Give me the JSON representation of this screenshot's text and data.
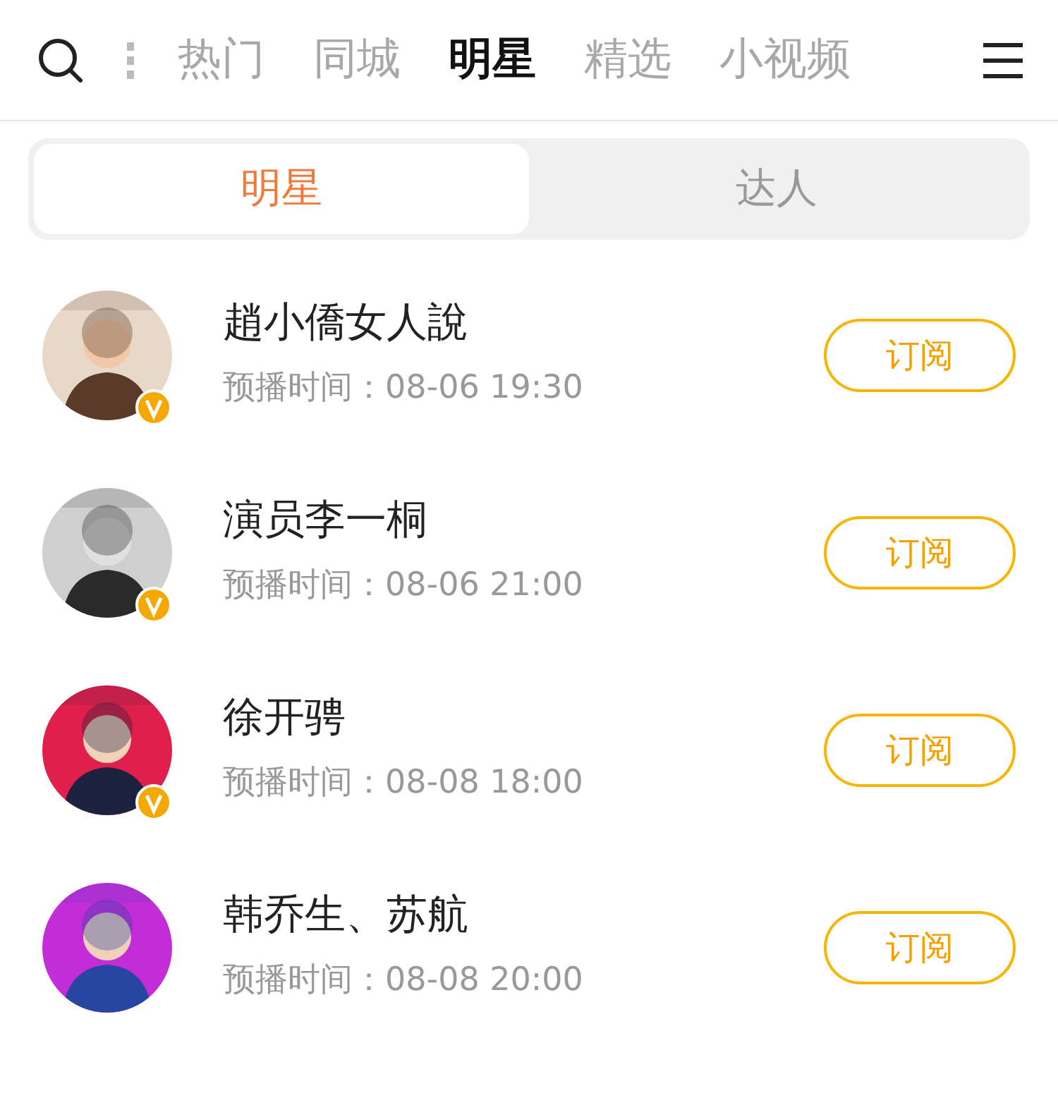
{
  "top_tabs": [
    {
      "label": "热门",
      "selected": false
    },
    {
      "label": "同城",
      "selected": false
    },
    {
      "label": "明星",
      "selected": true
    },
    {
      "label": "精选",
      "selected": false
    },
    {
      "label": "小视频",
      "selected": false
    }
  ],
  "segments": [
    {
      "label": "明星",
      "selected": true
    },
    {
      "label": "达人",
      "selected": false
    }
  ],
  "streams": [
    {
      "name": "趙小僑女人說",
      "time_label": "预播时间：",
      "time": "08-06 19:30",
      "verified": true,
      "button": "订阅"
    },
    {
      "name": "演员李一桐",
      "time_label": "预播时间：",
      "time": "08-06 21:00",
      "verified": true,
      "button": "订阅"
    },
    {
      "name": "徐开骋",
      "time_label": "预播时间：",
      "time": "08-08 18:00",
      "verified": true,
      "button": "订阅"
    },
    {
      "name": "韩乔生、苏航",
      "time_label": "预播时间：",
      "time": "08-08 20:00",
      "verified": false,
      "button": "订阅"
    }
  ]
}
